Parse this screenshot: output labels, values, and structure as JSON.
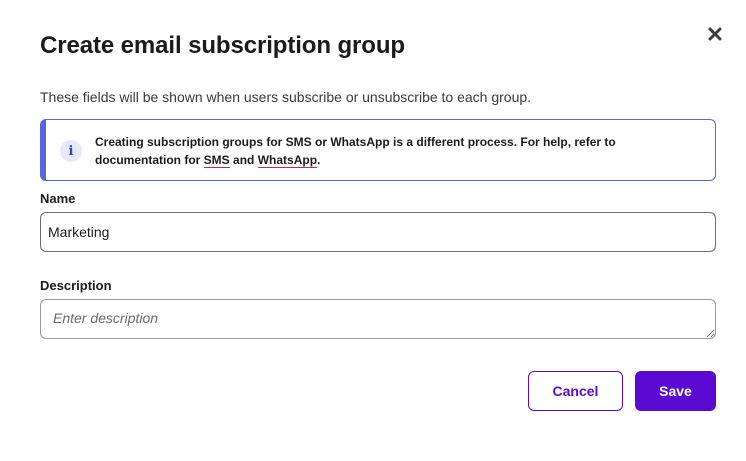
{
  "dialog": {
    "title": "Create email subscription group",
    "subtitle": "These fields will be shown when users subscribe or unsubscribe to each group.",
    "close_icon": "close-icon"
  },
  "info": {
    "icon": "info-icon",
    "icon_glyph": "i",
    "text_before": "Creating subscription groups for SMS or WhatsApp is a different process. For help, refer to documentation for ",
    "link_sms": "SMS",
    "text_and": " and ",
    "link_whatsapp": "WhatsApp",
    "text_end": ".",
    "accent_color": "#5566e0",
    "link_underline_color": "#c8245b"
  },
  "form": {
    "name_label": "Name",
    "name_value": "Marketing",
    "description_label": "Description",
    "description_placeholder": "Enter description"
  },
  "actions": {
    "cancel_label": "Cancel",
    "save_label": "Save",
    "primary_color": "#5b0bd1"
  }
}
